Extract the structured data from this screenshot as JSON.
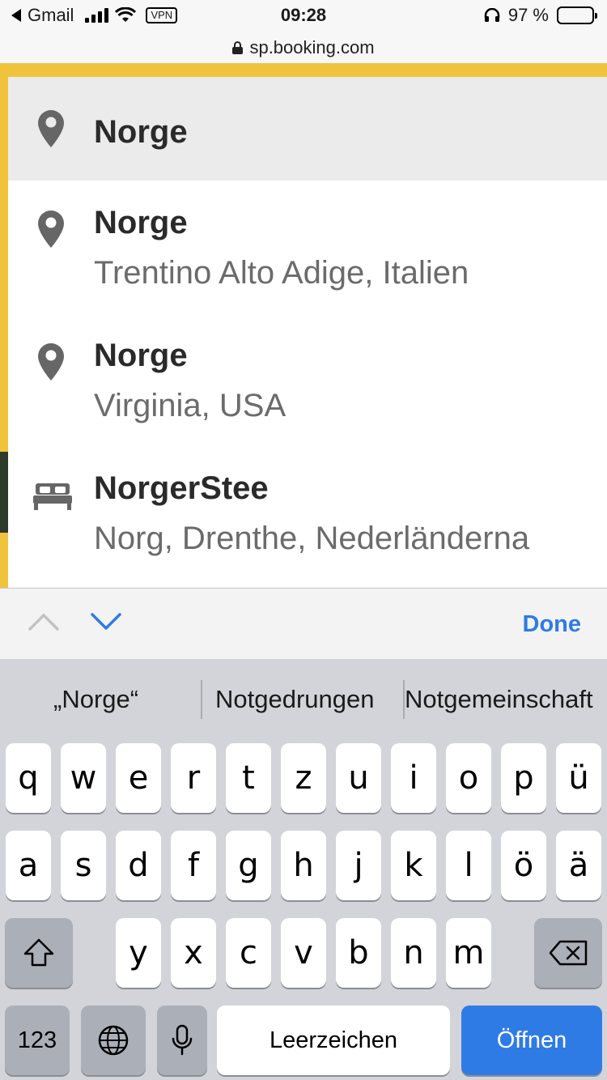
{
  "status_bar": {
    "back_app": "Gmail",
    "vpn": "VPN",
    "time": "09:28",
    "battery": "97 %"
  },
  "url_bar": {
    "host": "sp.booking.com"
  },
  "dropdown": {
    "typed_entry": {
      "title": "Norge",
      "icon": "map-pin-icon"
    },
    "results": [
      {
        "title": "Norge",
        "subtitle": "Trentino Alto Adige, Italien",
        "icon": "map-pin-icon"
      },
      {
        "title": "Norge",
        "subtitle": "Virginia, USA",
        "icon": "map-pin-icon"
      },
      {
        "title": "NorgerStee",
        "subtitle": "Norg, Drenthe, Nederländerna",
        "icon": "bed-icon"
      }
    ]
  },
  "accessory_bar": {
    "done_label": "Done"
  },
  "keyboard": {
    "suggestions": [
      "„Norge“",
      "Notgedrungen",
      "Notgemeinschaft"
    ],
    "row1": [
      "q",
      "w",
      "e",
      "r",
      "t",
      "z",
      "u",
      "i",
      "o",
      "p",
      "ü"
    ],
    "row2": [
      "a",
      "s",
      "d",
      "f",
      "g",
      "h",
      "j",
      "k",
      "l",
      "ö",
      "ä"
    ],
    "row3": [
      "y",
      "x",
      "c",
      "v",
      "b",
      "n",
      "m"
    ],
    "numbers_label": "123",
    "space_label": "Leerzeichen",
    "return_label": "Öffnen"
  },
  "colors": {
    "accent_blue": "#2f7be6",
    "booking_yellow": "#f0c33c"
  }
}
